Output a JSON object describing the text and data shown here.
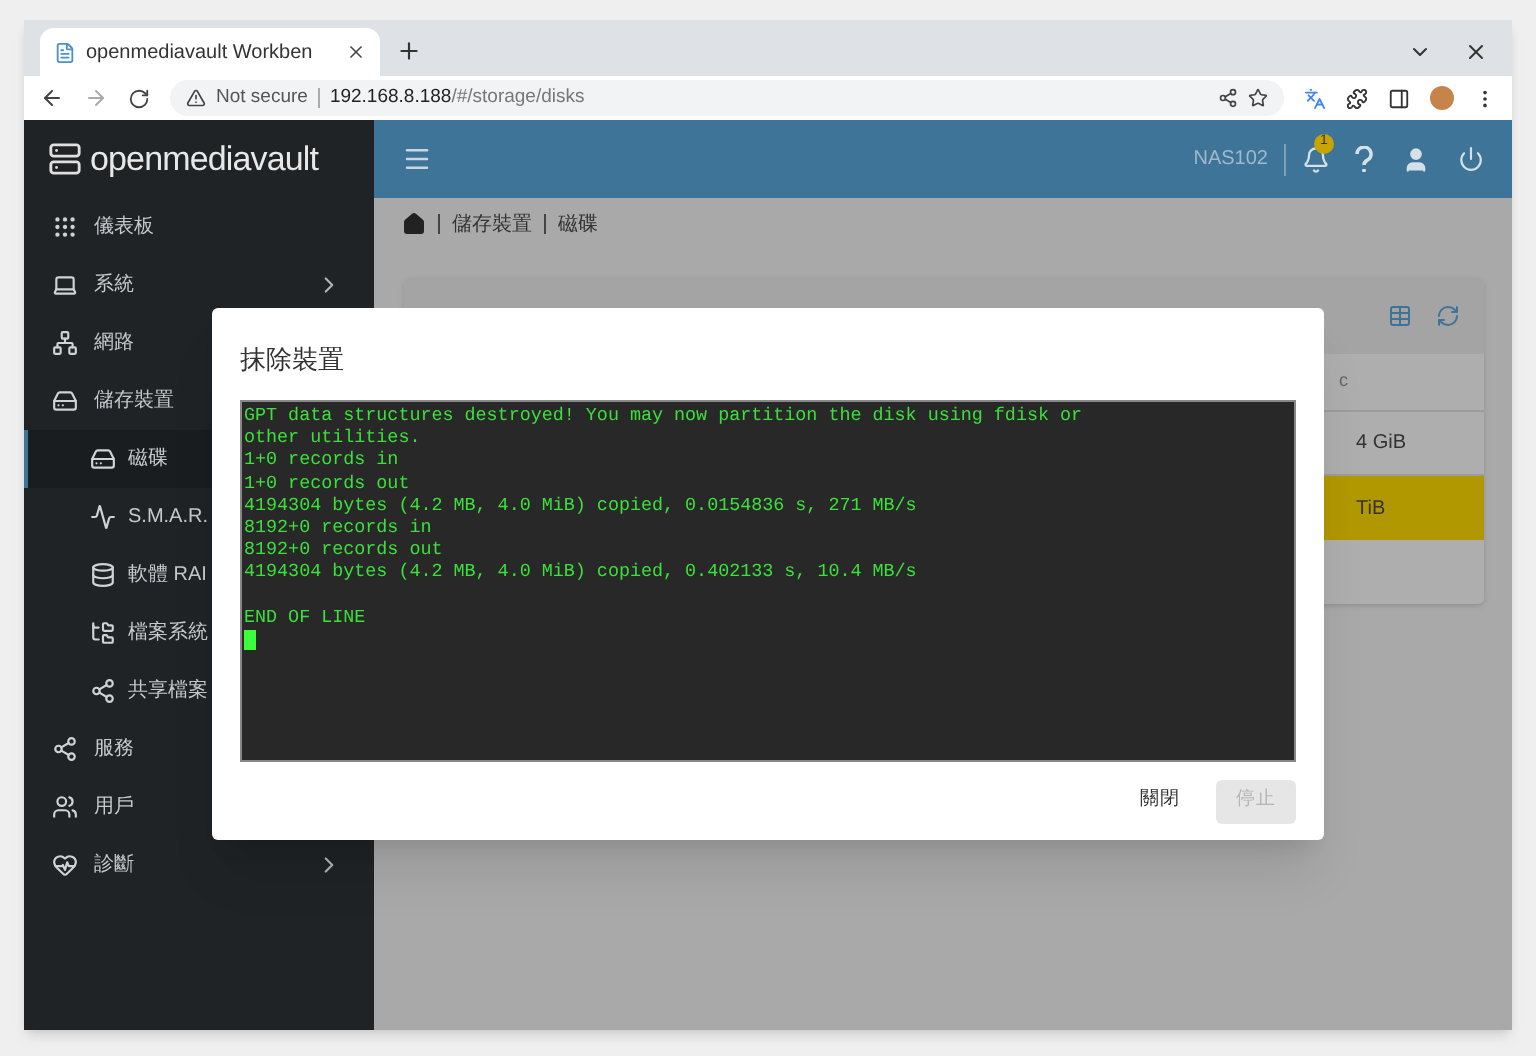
{
  "browser": {
    "tab_title": "openmediavault Workben",
    "security": "Not secure",
    "url_host": "192.168.8.188",
    "url_path": "/#/storage/disks"
  },
  "header": {
    "logo": "openmediavault",
    "hostname": "NAS102",
    "notification_count": "1"
  },
  "sidebar": {
    "items": [
      {
        "label": "儀表板",
        "selected": false
      },
      {
        "label": "系統",
        "selected": false,
        "expanded": false
      },
      {
        "label": "網路",
        "selected": false
      },
      {
        "label": "儲存裝置",
        "selected": false,
        "expanded": true,
        "children": [
          {
            "label": "磁碟",
            "selected": true
          },
          {
            "label": "S.M.A.R.",
            "selected": false
          },
          {
            "label": "軟體 RAI",
            "selected": false
          },
          {
            "label": "檔案系統",
            "selected": false
          },
          {
            "label": "共享檔案",
            "selected": false
          }
        ]
      },
      {
        "label": "服務",
        "selected": false
      },
      {
        "label": "用戶",
        "selected": false
      },
      {
        "label": "診斷",
        "selected": false,
        "expanded": false
      }
    ]
  },
  "breadcrumb": [
    "儲存裝置",
    "磁碟"
  ],
  "table": {
    "column_header": "c",
    "rows": [
      {
        "cell": "4 GiB",
        "selected": false
      },
      {
        "cell": "TiB",
        "selected": true
      }
    ]
  },
  "dialog": {
    "title": "抹除裝置",
    "terminal_lines": [
      {
        "text": "GPT data structures destroyed! You may now partition the disk using fdisk or",
        "blank_before": false
      },
      {
        "text": "other utilities.",
        "blank_before": false
      },
      {
        "text": "1+0 records in",
        "blank_before": false
      },
      {
        "text": "1+0 records out",
        "blank_before": false
      },
      {
        "text": "4194304 bytes (4.2 MB, 4.0 MiB) copied, 0.0154836 s, 271 MB/s",
        "blank_before": false
      },
      {
        "text": "8192+0 records in",
        "blank_before": false
      },
      {
        "text": "8192+0 records out",
        "blank_before": false
      },
      {
        "text": "4194304 bytes (4.2 MB, 4.0 MiB) copied, 0.402133 s, 10.4 MB/s",
        "blank_before": false
      },
      {
        "text": "END OF LINE",
        "blank_before": true
      }
    ],
    "buttons": [
      {
        "label": "關閉",
        "disabled": false
      },
      {
        "label": "停止",
        "disabled": true
      }
    ]
  }
}
